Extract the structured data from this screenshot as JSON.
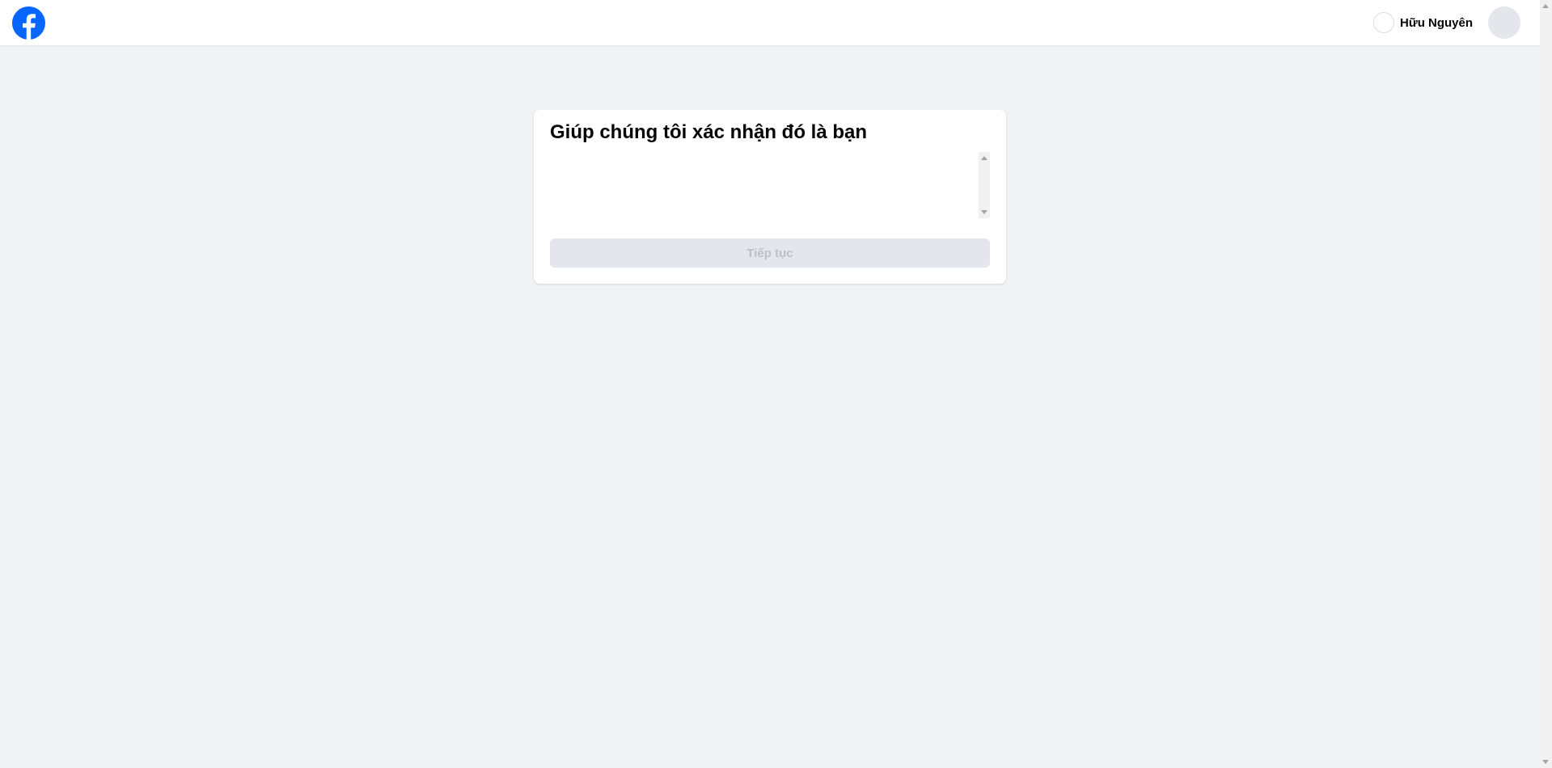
{
  "header": {
    "logo_icon": "facebook-logo-icon",
    "brand_color": "#0866ff",
    "account_name": "Hữu Nguyên"
  },
  "card": {
    "title": "Giúp chúng tôi xác nhận đó là bạn",
    "continue_label": "Tiếp tục",
    "continue_disabled": true
  },
  "colors": {
    "page_background": "#f0f2f5",
    "card_background": "#ffffff",
    "button_disabled_bg": "#e4e6eb",
    "button_disabled_text": "#bcc0c4"
  }
}
